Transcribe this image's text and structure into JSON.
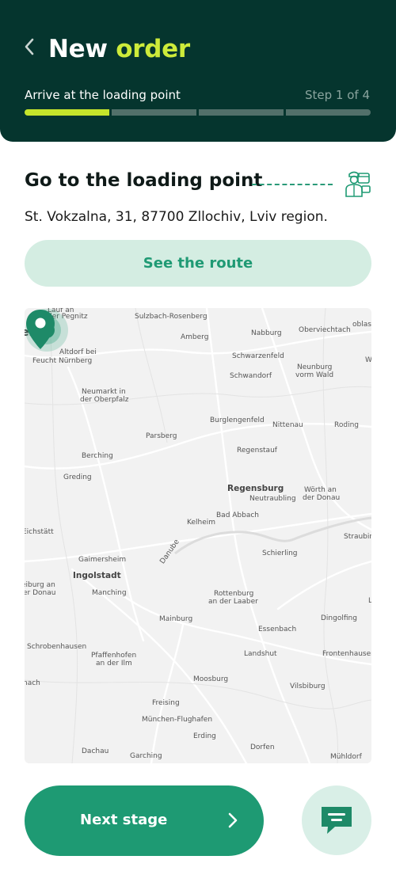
{
  "header": {
    "title_main": "New",
    "title_accent": "order",
    "step_label": "Arrive at the loading point",
    "step_count": "Step 1 of 4",
    "progress": {
      "current_step": 1,
      "total_steps": 4,
      "first_segment_fill": 0.98
    }
  },
  "section": {
    "title": "Go to the loading point",
    "address": "St. Vokzalna, 31, 87700 Zllochiv, Lviv region."
  },
  "route_button": {
    "label": "See the route"
  },
  "map": {
    "places": [
      {
        "name": "Lauf an",
        "size": "small"
      },
      {
        "name": "der Pegnitz",
        "size": "small"
      },
      {
        "name": "Sulzbach-Rosenberg",
        "size": "small"
      },
      {
        "name": "Amberg",
        "size": "small"
      },
      {
        "name": "Nabburg",
        "size": "small"
      },
      {
        "name": "Oberviechtach",
        "size": "small"
      },
      {
        "name": "erg",
        "size": "big"
      },
      {
        "name": "Altdorf bei",
        "size": "small"
      },
      {
        "name": "Feucht  Nürnberg",
        "size": "small"
      },
      {
        "name": "Schwarzenfeld",
        "size": "small"
      },
      {
        "name": "Neunburg",
        "size": "small"
      },
      {
        "name": "vorm Wald",
        "size": "small"
      },
      {
        "name": "Schwandorf",
        "size": "small"
      },
      {
        "name": "Neumarkt in",
        "size": "small"
      },
      {
        "name": "der Oberpfalz",
        "size": "small"
      },
      {
        "name": "Burglengenfeld",
        "size": "small"
      },
      {
        "name": "Nittenau",
        "size": "small"
      },
      {
        "name": "Roding",
        "size": "small"
      },
      {
        "name": "Parsberg",
        "size": "small"
      },
      {
        "name": "Regenstauf",
        "size": "small"
      },
      {
        "name": "Berching",
        "size": "small"
      },
      {
        "name": "Greding",
        "size": "small"
      },
      {
        "name": "Regensburg",
        "size": "big"
      },
      {
        "name": "Neutraubling",
        "size": "small"
      },
      {
        "name": "Wörth an",
        "size": "small"
      },
      {
        "name": "der Donau",
        "size": "small"
      },
      {
        "name": "Bad Abbach",
        "size": "small"
      },
      {
        "name": "Kelheim",
        "size": "small"
      },
      {
        "name": "Eichstätt",
        "size": "small"
      },
      {
        "name": "Straubin",
        "size": "small"
      },
      {
        "name": "Danube",
        "size": "small"
      },
      {
        "name": "Gaimersheim",
        "size": "small"
      },
      {
        "name": "Schierling",
        "size": "small"
      },
      {
        "name": "Ingolstadt",
        "size": "big"
      },
      {
        "name": "eiburg an",
        "size": "small"
      },
      {
        "name": "er Donau",
        "size": "small"
      },
      {
        "name": "Manching",
        "size": "small"
      },
      {
        "name": "Rottenburg",
        "size": "small"
      },
      {
        "name": "an der Laaber",
        "size": "small"
      },
      {
        "name": "Mainburg",
        "size": "small"
      },
      {
        "name": "Dingolfing",
        "size": "small"
      },
      {
        "name": "Essenbach",
        "size": "small"
      },
      {
        "name": "Schrobenhausen",
        "size": "small"
      },
      {
        "name": "Pfaffenhofen",
        "size": "small"
      },
      {
        "name": "an der Ilm",
        "size": "small"
      },
      {
        "name": "Landshut",
        "size": "small"
      },
      {
        "name": "Frontenhausen",
        "size": "small"
      },
      {
        "name": "nach",
        "size": "small"
      },
      {
        "name": "Moosburg",
        "size": "small"
      },
      {
        "name": "Vilsbiburg",
        "size": "small"
      },
      {
        "name": "Freising",
        "size": "small"
      },
      {
        "name": "München-Flughafen",
        "size": "small"
      },
      {
        "name": "Erding",
        "size": "small"
      },
      {
        "name": "Dachau",
        "size": "small"
      },
      {
        "name": "Garching",
        "size": "small"
      },
      {
        "name": "Dorfen",
        "size": "small"
      },
      {
        "name": "Mühldorf",
        "size": "small"
      },
      {
        "name": "oblas",
        "size": "small"
      },
      {
        "name": "W",
        "size": "small"
      },
      {
        "name": "L",
        "size": "small"
      }
    ]
  },
  "footer": {
    "next_label": "Next stage"
  },
  "colors": {
    "header_bg": "#05352e",
    "accent_lime": "#c6e52b",
    "brand_green": "#1e9a73",
    "route_button_bg": "#d4ede2"
  },
  "icons": {
    "back": "chevron-left-icon",
    "worker": "delivery-worker-icon",
    "pin": "map-pin-icon",
    "current_location": "location-dot-icon",
    "next": "chevron-right-icon",
    "chat": "chat-bubble-icon"
  }
}
